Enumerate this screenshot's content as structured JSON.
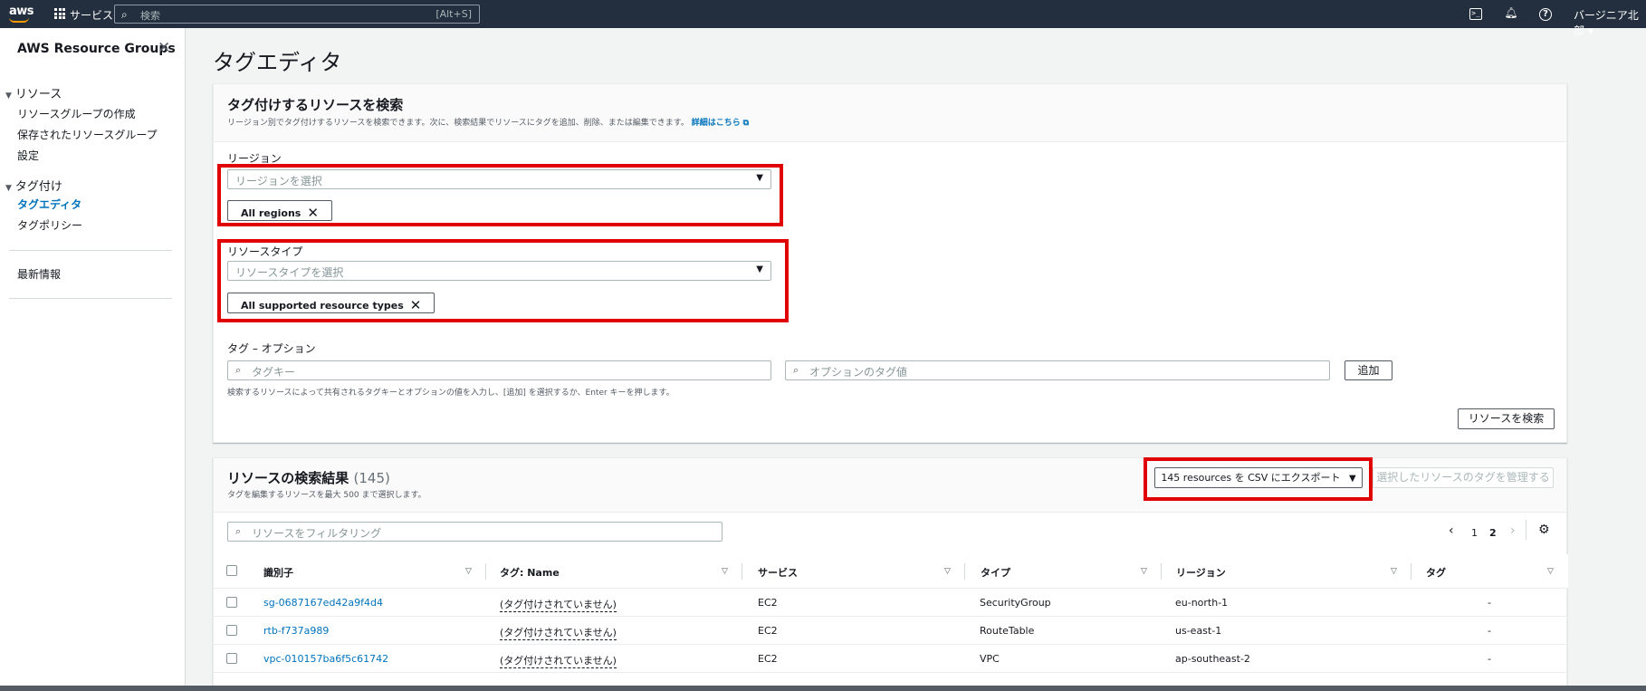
{
  "topnav": {
    "logo": "aws",
    "services_label": "サービス",
    "search_placeholder": "検索",
    "search_shortcut": "[Alt+S]",
    "region": "バージニア北部 ▾",
    "icons": [
      "cloudshell-icon",
      "bell-icon",
      "help-icon"
    ]
  },
  "sidebar": {
    "title": "AWS Resource Groups",
    "sections": [
      {
        "label": "リソース",
        "items": [
          "リソースグループの作成",
          "保存されたリソースグループ",
          "設定"
        ]
      },
      {
        "label": "タグ付け",
        "items": [
          "タグエディタ",
          "タグポリシー"
        ],
        "active": "タグエディタ"
      }
    ],
    "extra": "最新情報"
  },
  "page": {
    "title": "タグエディタ"
  },
  "search_panel": {
    "title": "タグ付けするリソースを検索",
    "description": "リージョン別でタグ付けするリソースを検索できます。次に、検索結果でリソースにタグを追加、削除、または編集できます。",
    "details_link": "詳細はこちら",
    "region_label": "リージョン",
    "region_placeholder": "リージョンを選択",
    "region_token": "All regions",
    "resource_type_label": "リソースタイプ",
    "resource_type_placeholder": "リソースタイプを選択",
    "resource_type_token": "All supported resource types",
    "tag_label": "タグ – オプション",
    "tag_key_placeholder": "タグキー",
    "tag_value_placeholder": "オプションのタグ値",
    "add_button": "追加",
    "tag_hint": "検索するリソースによって共有されるタグキーとオプションの値を入力し、[追加] を選択するか、Enter キーを押します。",
    "search_button": "リソースを検索"
  },
  "results_panel": {
    "title": "リソースの検索結果",
    "count": "(145)",
    "description": "タグを編集するリソースを最大 500 まで選択します。",
    "export_button": "145 resources を CSV にエクスポート",
    "manage_button": "選択したリソースのタグを管理する",
    "filter_placeholder": "リソースをフィルタリング",
    "pages": [
      "1",
      "2"
    ],
    "columns": [
      "識別子",
      "タグ: Name",
      "サービス",
      "タイプ",
      "リージョン",
      "タグ"
    ],
    "rows": [
      {
        "id": "sg-0687167ed42a9f4d4",
        "name": "(タグ付けされていません)",
        "service": "EC2",
        "type": "SecurityGroup",
        "region": "eu-north-1",
        "tags": "-"
      },
      {
        "id": "rtb-f737a989",
        "name": "(タグ付けされていません)",
        "service": "EC2",
        "type": "RouteTable",
        "region": "us-east-1",
        "tags": "-"
      },
      {
        "id": "vpc-010157ba6f5c61742",
        "name": "(タグ付けされていません)",
        "service": "EC2",
        "type": "VPC",
        "region": "ap-southeast-2",
        "tags": "-"
      }
    ]
  },
  "colors": {
    "accent": "#0073bb",
    "highlight": "#e00000",
    "nav_bg": "#232f3e",
    "aws_orange": "#ff9900"
  }
}
